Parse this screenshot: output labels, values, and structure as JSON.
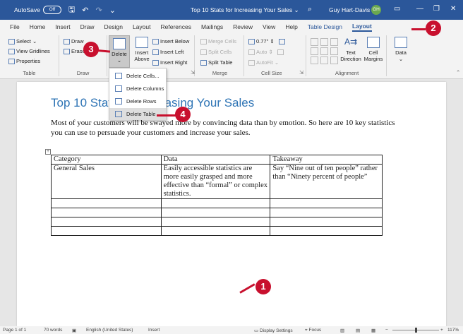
{
  "titlebar": {
    "autosave_label": "AutoSave",
    "autosave_state": "Off",
    "doc_title": "Top 10 Stats for Increasing Your Sales",
    "title_chevron": "⌄",
    "user_name": "Guy Hart-Davis",
    "user_initials": "GH"
  },
  "tabs": [
    "File",
    "Home",
    "Insert",
    "Draw",
    "Design",
    "Layout",
    "References",
    "Mailings",
    "Review",
    "View",
    "Help",
    "Table Design",
    "Layout"
  ],
  "ribbon": {
    "table_group": {
      "select": "Select",
      "view_gridlines": "View Gridlines",
      "properties": "Properties",
      "label": "Table"
    },
    "draw_group": {
      "draw": "Draw",
      "eraser": "Eraser",
      "label": "Draw"
    },
    "rows_group": {
      "delete": "Delete",
      "insert_above_1": "Insert",
      "insert_above_2": "Above",
      "insert_below": "Insert Below",
      "insert_left": "Insert Left",
      "insert_right": "Insert Right"
    },
    "merge_group": {
      "merge_cells": "Merge Cells",
      "split_cells": "Split Cells",
      "split_table": "Split Table",
      "label": "Merge"
    },
    "cellsize_group": {
      "height": "0.77\"",
      "width": "Auto",
      "autofit": "AutoFit",
      "label": "Cell Size"
    },
    "alignment_group": {
      "text_direction_1": "Text",
      "text_direction_2": "Direction",
      "cell_margins_1": "Cell",
      "cell_margins_2": "Margins",
      "label": "Alignment"
    },
    "data_group": {
      "data": "Data"
    }
  },
  "dropdown": [
    "Delete Cells...",
    "Delete Columns",
    "Delete Rows",
    "Delete Table"
  ],
  "document": {
    "heading": "Top 10 Stats for Increasing Your Sales",
    "body": "Most of your customers will be swayed more by convincing data than by emotion. So here are 10 key statistics you can use to persuade your customers and increase your sales.",
    "table": {
      "headers": [
        "Category",
        "Data",
        "Takeaway"
      ],
      "row1": [
        "General Sales",
        "Easily accessible statistics are more easily grasped and more effective than “formal” or complex statistics.",
        "Say “Nine out of ten people” rather than “Ninety percent of people”"
      ]
    }
  },
  "statusbar": {
    "page": "Page 1 of 1",
    "words": "70 words",
    "language": "English (United States)",
    "mode": "Insert",
    "display_settings": "Display Settings",
    "focus": "Focus",
    "zoom": "117%"
  },
  "callouts": [
    "1",
    "2",
    "3",
    "4"
  ]
}
